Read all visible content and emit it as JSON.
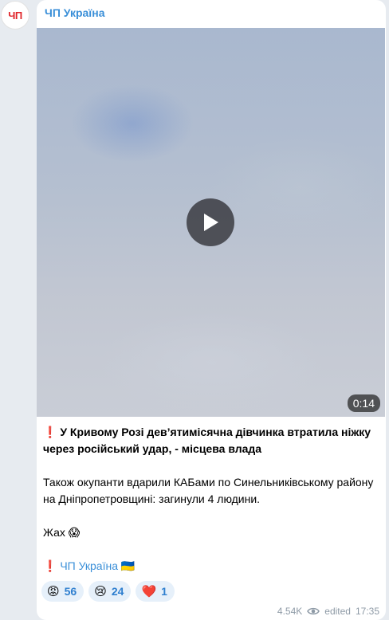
{
  "channel": {
    "avatar_text": "ЧП",
    "name": "ЧП Україна"
  },
  "video": {
    "duration": "0:14"
  },
  "post": {
    "headline_icon": "❗",
    "headline": "У Кривому Розі дев’ятимісячна дівчинка втратила ніжку через російський удар, - місцева влада",
    "body": "Також окупанти вдарили КАБами по Синельниківському району на Дніпропетровщині: загинули 4 людини.",
    "reaction_line": "Жах",
    "reaction_line_emoji": "😱",
    "signature_icon": "❗",
    "signature_link": "ЧП Україна",
    "signature_flag": "🇺🇦"
  },
  "reactions": [
    {
      "emoji": "😡",
      "count": "56"
    },
    {
      "emoji": "😢",
      "count": "24"
    },
    {
      "emoji": "❤️",
      "count": "1"
    }
  ],
  "meta": {
    "views": "4.54K",
    "edited_label": "edited",
    "time": "17:35"
  },
  "colors": {
    "accent": "#3a8fd8",
    "reaction_bg": "#e6f0fa",
    "background": "#e7ebf0"
  }
}
